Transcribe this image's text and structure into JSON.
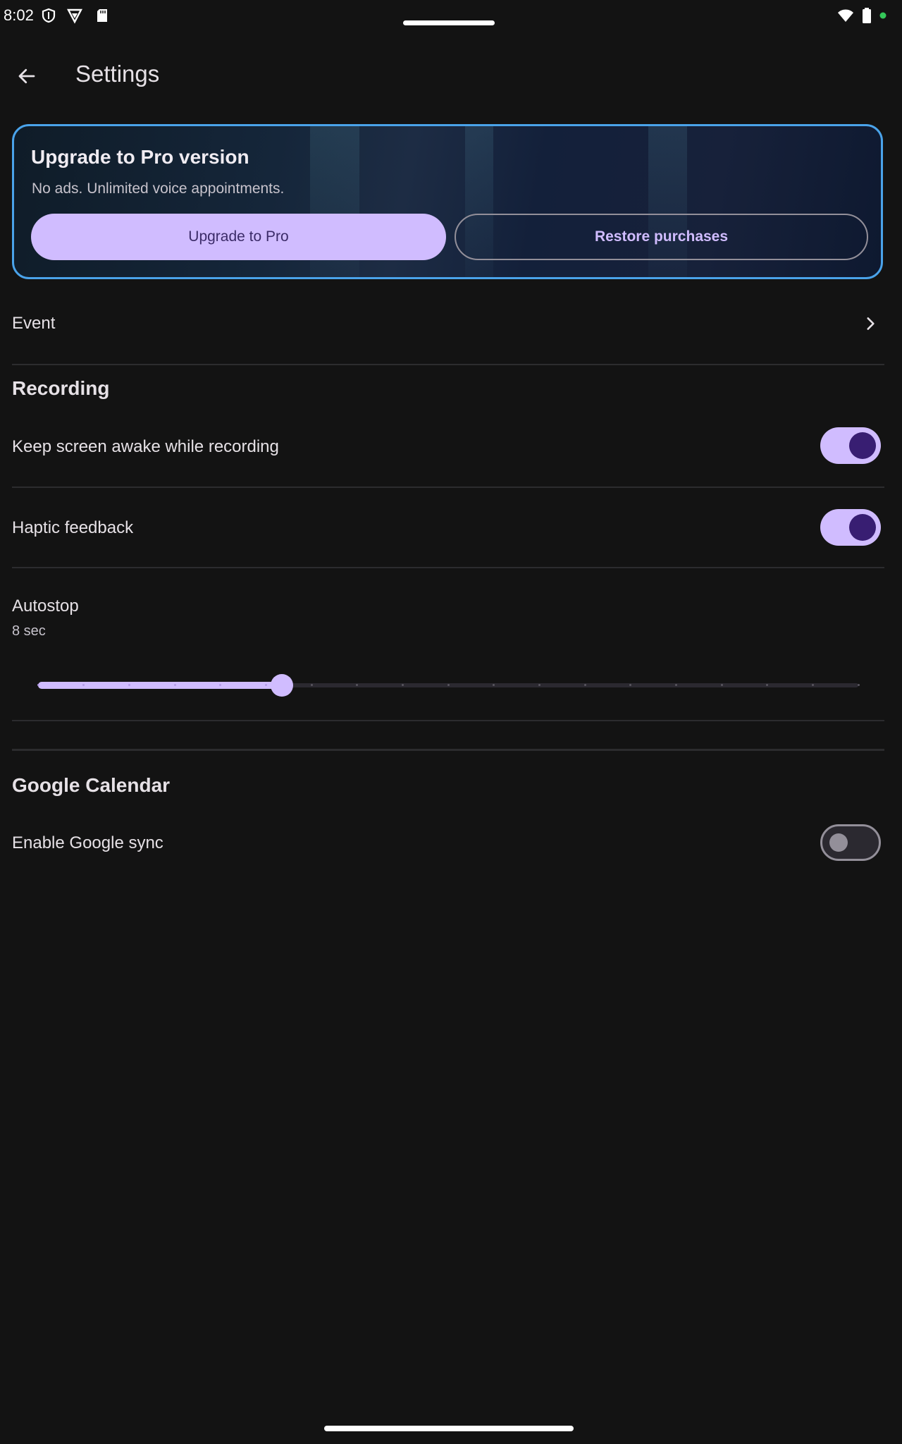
{
  "status_bar": {
    "time": "8:02",
    "icons": [
      "shield-icon",
      "vpn-icon",
      "sd-card-icon",
      "wifi-icon",
      "battery-icon",
      "privacy-dot-icon"
    ]
  },
  "app_bar": {
    "back_icon": "arrow-back-icon",
    "title": "Settings"
  },
  "pro_card": {
    "title": "Upgrade to Pro version",
    "subtitle": "No ads. Unlimited voice appointments.",
    "upgrade_label": "Upgrade to Pro",
    "restore_label": "Restore purchases"
  },
  "event_row": {
    "label": "Event",
    "icon": "chevron-right-icon"
  },
  "recording": {
    "header": "Recording",
    "keep_awake": {
      "label": "Keep screen awake while recording",
      "checked": true
    },
    "haptic": {
      "label": "Haptic feedback",
      "checked": true
    },
    "autostop": {
      "label": "Autostop",
      "value_text": "8 sec",
      "slider_fraction": 0.297,
      "tick_count": 18
    }
  },
  "google_calendar": {
    "header": "Google Calendar",
    "sync": {
      "label": "Enable Google sync",
      "checked": false
    }
  },
  "colors": {
    "background": "#131313",
    "accent": "#d0bcff",
    "on_accent": "#381e72",
    "card_border": "#4aa3ea",
    "divider": "#2c2c2e"
  }
}
